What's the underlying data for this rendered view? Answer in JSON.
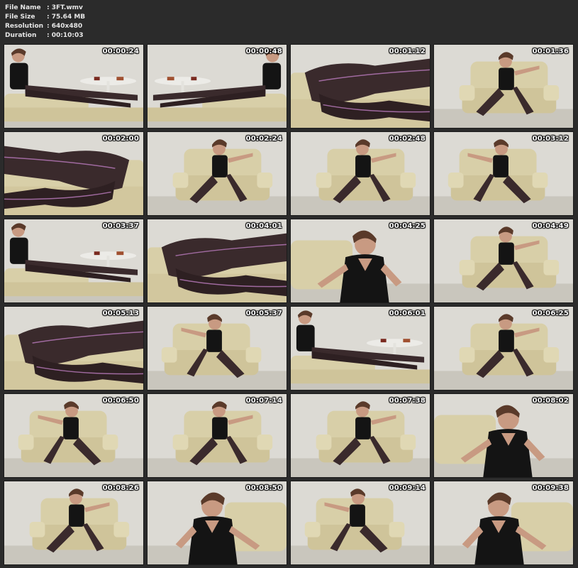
{
  "file_info": {
    "name_label": "File Name",
    "name_value": ":   3FT.wmv",
    "size_label": "File Size",
    "size_value": ":   75.64 MB",
    "resolution_label": "Resolution",
    "resolution_value": ":   640x480",
    "duration_label": "Duration",
    "duration_value": ":   00:10:03"
  },
  "thumbnails": [
    {
      "time": "00:00:24"
    },
    {
      "time": "00:00:48"
    },
    {
      "time": "00:01:12"
    },
    {
      "time": "00:01:36"
    },
    {
      "time": "00:02:00"
    },
    {
      "time": "00:02:24"
    },
    {
      "time": "00:02:48"
    },
    {
      "time": "00:03:12"
    },
    {
      "time": "00:03:37"
    },
    {
      "time": "00:04:01"
    },
    {
      "time": "00:04:25"
    },
    {
      "time": "00:04:49"
    },
    {
      "time": "00:05:13"
    },
    {
      "time": "00:05:37"
    },
    {
      "time": "00:06:01"
    },
    {
      "time": "00:06:25"
    },
    {
      "time": "00:06:50"
    },
    {
      "time": "00:07:14"
    },
    {
      "time": "00:07:38"
    },
    {
      "time": "00:08:02"
    },
    {
      "time": "00:08:26"
    },
    {
      "time": "00:08:50"
    },
    {
      "time": "00:09:14"
    },
    {
      "time": "00:09:38"
    }
  ],
  "colors": {
    "background": "#2b2b2b",
    "header_text": "#e6e6e6",
    "timestamp_text": "#ffffff",
    "wall": "#dcdad4",
    "leather": "#d8cfa8",
    "dress": "#141414",
    "hosiery": "#3a2a2c"
  }
}
